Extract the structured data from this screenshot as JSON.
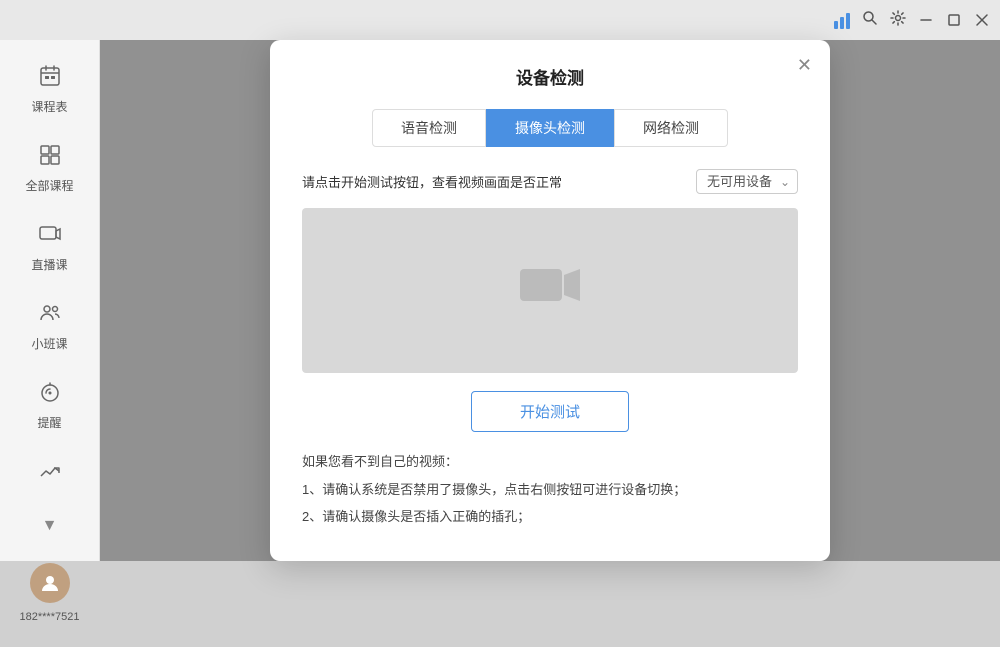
{
  "titlebar": {
    "signal_icon": "📶",
    "search_icon": "🔍",
    "settings_icon": "⚙️",
    "minimize_label": "—",
    "maximize_label": "□",
    "close_label": "✕"
  },
  "sidebar": {
    "items": [
      {
        "id": "schedule",
        "label": "课程表",
        "icon": "📋"
      },
      {
        "id": "all-courses",
        "label": "全部课程",
        "icon": "📚"
      },
      {
        "id": "live",
        "label": "直播课",
        "icon": "📺"
      },
      {
        "id": "small-class",
        "label": "小班课",
        "icon": "👥"
      },
      {
        "id": "reminder",
        "label": "提醒",
        "icon": "💬"
      },
      {
        "id": "stats",
        "label": "",
        "icon": "📈"
      }
    ],
    "avatar": {
      "label": "182****7521",
      "icon": "👤"
    }
  },
  "modal": {
    "title": "设备检测",
    "close_label": "✕",
    "tabs": [
      {
        "id": "audio",
        "label": "语音检测",
        "active": false
      },
      {
        "id": "camera",
        "label": "摄像头检测",
        "active": true
      },
      {
        "id": "network",
        "label": "网络检测",
        "active": false
      }
    ],
    "description": "请点击开始测试按钮，查看视频画面是否正常",
    "device_select": {
      "placeholder": "无可用设备",
      "options": [
        "无可用设备"
      ]
    },
    "start_button": "开始测试",
    "help": {
      "title": "如果您看不到自己的视频：",
      "items": [
        "1、请确认系统是否禁用了摄像头，点击右侧按钮可进行设备切换；",
        "2、请确认摄像头是否插入正确的插孔；"
      ]
    }
  }
}
